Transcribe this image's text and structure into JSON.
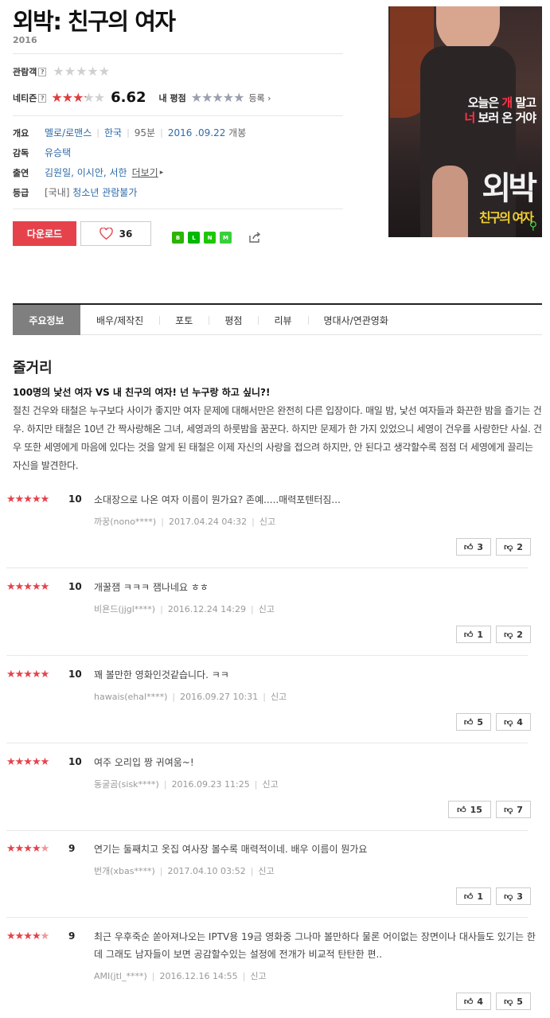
{
  "movie": {
    "title": "외박: 친구의 여자",
    "year": "2016",
    "audience_label": "관람객",
    "netizen_label": "네티즌",
    "netizen_score": "6.62",
    "my_rating_label": "내 평점",
    "register_label": "등록",
    "info": {
      "overview_key": "개요",
      "genre": "멜로/로맨스",
      "country": "한국",
      "runtime": "95분",
      "release_date": "2016 .09.22",
      "release_suffix": "개봉",
      "director_key": "감독",
      "director": "유승택",
      "cast_key": "출연",
      "cast": "김원일, 이시안, 서한",
      "more_label": "더보기",
      "rating_key": "등급",
      "rating_region": "[국내]",
      "rating": "청소년 관람불가"
    },
    "download_label": "다운로드",
    "like_count": "36",
    "share_icons": [
      {
        "name": "band-icon",
        "color": "#2db400",
        "text": "B"
      },
      {
        "name": "line-icon",
        "color": "#00b900",
        "text": "L"
      },
      {
        "name": "bookmark-icon",
        "color": "#1ec800",
        "text": "N"
      },
      {
        "name": "memo-icon",
        "color": "#3ad03a",
        "text": "M"
      }
    ],
    "poster": {
      "tagline_1a": "오늘은 ",
      "tagline_1b": "개",
      "tagline_1c": " 말고",
      "tagline_2a": "너",
      "tagline_2b": " 보러 온 거야",
      "poster_title": "외박",
      "poster_subtitle": "친구의 여자"
    }
  },
  "tabs": [
    "주요정보",
    "배우/제작진",
    "포토",
    "평점",
    "리뷰",
    "명대사/연관영화"
  ],
  "synopsis": {
    "heading": "줄거리",
    "subtitle": "100명의 낯선 여자 VS 내 친구의 여자! 넌 누구랑 하고 싶니?!",
    "body": "절친 건우와 태철은 누구보다 사이가 좋지만 여자 문제에 대해서만은 완전히 다른 입장이다. 매일 밤, 낯선 여자들과 화끈한 밤을 즐기는 건우. 하지만 태철은 10년 간 짝사랑해온 그녀, 세영과의 하룻밤을 꿈꾼다. 하지만 문제가 한 가지 있었으니 세영이 건우를 사랑한단 사실. 건우 또한 세영에게 마음에 있다는 것을 알게 된 태철은 이제 자신의 사랑을 접으려 하지만, 안 된다고 생각할수록 점점 더 세영에게 끌리는 자신을 발견한다."
  },
  "reviews": [
    {
      "score": "10",
      "stars": 5,
      "text": "소대장으로 나온 여자 이름이 뭔가요? 존예.....매력포텐터짐...",
      "user": "까꿍(nono****)",
      "date": "2017.04.24 04:32",
      "report": "신고",
      "up": "3",
      "down": "2"
    },
    {
      "score": "10",
      "stars": 5,
      "text": "개꿀잼 ㅋㅋㅋ 잼나네요 ㅎㅎ",
      "user": "비욘드(jjgl****)",
      "date": "2016.12.24 14:29",
      "report": "신고",
      "up": "1",
      "down": "2"
    },
    {
      "score": "10",
      "stars": 5,
      "text": "꽤 볼만한 영화인것같습니다. ㅋㅋ",
      "user": "hawais(ehal****)",
      "date": "2016.09.27 10:31",
      "report": "신고",
      "up": "5",
      "down": "4"
    },
    {
      "score": "10",
      "stars": 5,
      "text": "여주 오리입 짱 귀여움~!",
      "user": "동굴곰(sisk****)",
      "date": "2016.09.23 11:25",
      "report": "신고",
      "up": "15",
      "down": "7"
    },
    {
      "score": "9",
      "stars": 4.5,
      "text": "연기는 둘째치고 옷집 여사장 볼수록 매력적이네. 배우 이름이 뭔가요",
      "user": "번개(xbas****)",
      "date": "2017.04.10 03:52",
      "report": "신고",
      "up": "1",
      "down": "3"
    },
    {
      "score": "9",
      "stars": 4.5,
      "text": "최근 우후죽순 쏟아져나오는 IPTV용 19금 영화중 그나마 볼만하다 물론 어이없는 장면이나 대사들도 있기는 한데 그래도 남자들이 보면 공감할수있는 설정에 전개가 비교적 탄탄한 편..",
      "user": "AMI(jtl_****)",
      "date": "2016.12.16 14:55",
      "report": "신고",
      "up": "4",
      "down": "5"
    }
  ]
}
